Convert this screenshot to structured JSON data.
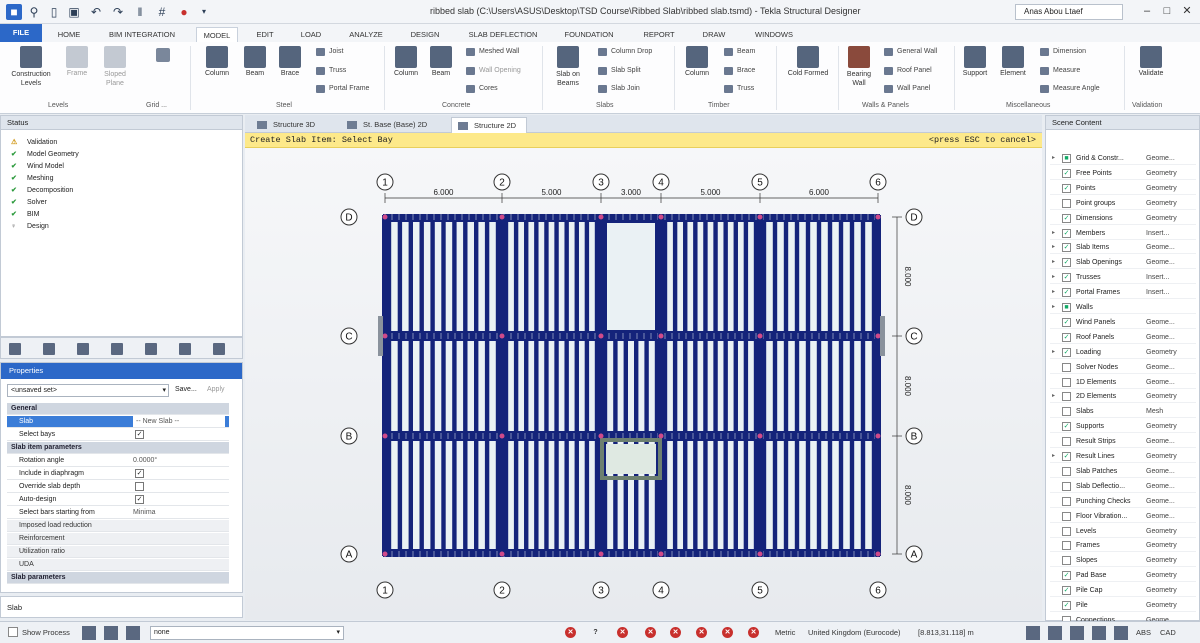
{
  "window": {
    "title": "ribbed slab (C:\\Users\\ASUS\\Desktop\\TSD Course\\Ribbed Slab\\ribbed slab.tsmd) - Tekla Structural Designer",
    "user": "Anas Abou Ltaef",
    "controls": [
      "–",
      "□",
      "✕"
    ]
  },
  "ribbon_tabs": [
    "FILE",
    "HOME",
    "BIM INTEGRATION",
    "MODEL",
    "EDIT",
    "LOAD",
    "ANALYZE",
    "DESIGN",
    "SLAB DEFLECTION",
    "FOUNDATION",
    "REPORT",
    "DRAW",
    "WINDOWS"
  ],
  "ribbon": {
    "construction_levels": "Construction Levels",
    "frame": "Frame",
    "sloped_plane": "Sloped Plane",
    "grid_label": "Grid ...",
    "levels_group": "Levels",
    "steel_column": "Column",
    "steel_beam": "Beam",
    "steel_brace": "Brace",
    "joist": "Joist",
    "truss": "Truss",
    "portal_frame": "Portal Frame",
    "steel_group": "Steel",
    "conc_column": "Column",
    "conc_beam": "Beam",
    "meshed_wall": "Meshed Wall",
    "wall_opening": "Wall Opening",
    "cores": "Cores",
    "concrete_group": "Concrete",
    "slab_on_beams": "Slab on Beams",
    "column_drop": "Column Drop",
    "slab_split": "Slab Split",
    "slab_join": "Slab Join",
    "slabs_group": "Slabs",
    "timber_column": "Column",
    "timber_beam": "Beam",
    "timber_brace": "Brace",
    "timber_truss": "Truss",
    "timber_group": "Timber",
    "cold_formed": "Cold Formed",
    "bearing_wall": "Bearing Wall",
    "general_wall": "General Wall",
    "roof_panel": "Roof Panel",
    "wall_panel": "Wall Panel",
    "walls_group": "Walls & Panels",
    "support": "Support",
    "element": "Element",
    "dimension": "Dimension",
    "measure": "Measure",
    "measure_angle": "Measure Angle",
    "misc_group": "Miscellaneous",
    "validate": "Validate",
    "validation_group": "Validation"
  },
  "status_panel": {
    "title": "Status",
    "items": [
      "Validation",
      "Model Geometry",
      "Wind Model",
      "Meshing",
      "Decomposition",
      "Solver",
      "BIM",
      "Design"
    ]
  },
  "properties": {
    "title": "Properties",
    "set": "<unsaved set>",
    "save": "Save...",
    "apply": "Apply",
    "rows": [
      {
        "kind": "sec",
        "label": "General",
        "value": ""
      },
      {
        "kind": "sel",
        "label": "Slab",
        "value": "-- New Slab --"
      },
      {
        "kind": "chk",
        "label": "Select bays",
        "value": "✓"
      },
      {
        "kind": "sec",
        "label": "Slab item parameters",
        "value": ""
      },
      {
        "kind": "val",
        "label": "Rotation angle",
        "value": "0.0000°"
      },
      {
        "kind": "chk",
        "label": "Include in diaphragm",
        "value": "✓"
      },
      {
        "kind": "chk",
        "label": "Override slab depth",
        "value": ""
      },
      {
        "kind": "chk",
        "label": "Auto-design",
        "value": "✓"
      },
      {
        "kind": "val",
        "label": "Select bars starting from",
        "value": "Minima"
      },
      {
        "kind": "sub",
        "label": "Imposed load reduction",
        "value": ""
      },
      {
        "kind": "sub",
        "label": "Reinforcement",
        "value": ""
      },
      {
        "kind": "sub",
        "label": "Utilization ratio",
        "value": ""
      },
      {
        "kind": "sub",
        "label": "UDA",
        "value": ""
      },
      {
        "kind": "sec",
        "label": "Slab parameters",
        "value": ""
      }
    ],
    "footer": "Slab"
  },
  "view_tabs": [
    "Structure 3D",
    "St. Base (Base) 2D",
    "Structure 2D"
  ],
  "prompt": {
    "left": "Create Slab Item: Select Bay",
    "right": "<press ESC to cancel>"
  },
  "grid": {
    "col_labels": [
      "1",
      "2",
      "3",
      "4",
      "5",
      "6"
    ],
    "row_labels": [
      "D",
      "C",
      "B",
      "A"
    ],
    "spans_x": [
      "6.000",
      "5.000",
      "3.000",
      "5.000",
      "6.000"
    ],
    "spans_y": [
      "8.000",
      "8.000",
      "8.000"
    ]
  },
  "scene_content": {
    "title": "Scene Content",
    "rows": [
      {
        "name": "Grid & Constr...",
        "type": "Geome...",
        "checked": "■",
        "exp": "▸"
      },
      {
        "name": "Free Points",
        "type": "Geometry",
        "checked": "✓",
        "exp": ""
      },
      {
        "name": "Points",
        "type": "Geometry",
        "checked": "✓",
        "exp": ""
      },
      {
        "name": "Point groups",
        "type": "Geometry",
        "checked": "",
        "exp": ""
      },
      {
        "name": "Dimensions",
        "type": "Geometry",
        "checked": "✓",
        "exp": ""
      },
      {
        "name": "Members",
        "type": "Insert...",
        "checked": "✓",
        "exp": "▸"
      },
      {
        "name": "Slab Items",
        "type": "Geome...",
        "checked": "✓",
        "exp": "▸"
      },
      {
        "name": "Slab Openings",
        "type": "Geome...",
        "checked": "✓",
        "exp": "▸"
      },
      {
        "name": "Trusses",
        "type": "Insert...",
        "checked": "✓",
        "exp": "▸"
      },
      {
        "name": "Portal Frames",
        "type": "Insert...",
        "checked": "✓",
        "exp": "▸"
      },
      {
        "name": "Walls",
        "type": "",
        "checked": "■",
        "exp": "▸"
      },
      {
        "name": "Wind Panels",
        "type": "Geome...",
        "checked": "✓",
        "exp": ""
      },
      {
        "name": "Roof Panels",
        "type": "Geome...",
        "checked": "✓",
        "exp": ""
      },
      {
        "name": "Loading",
        "type": "Geometry",
        "checked": "✓",
        "exp": "▸"
      },
      {
        "name": "Solver Nodes",
        "type": "Geome...",
        "checked": "",
        "exp": ""
      },
      {
        "name": "1D Elements",
        "type": "Geome...",
        "checked": "",
        "exp": ""
      },
      {
        "name": "2D Elements",
        "type": "Geometry",
        "checked": "",
        "exp": "▸"
      },
      {
        "name": "Slabs",
        "type": "Mesh",
        "checked": "",
        "exp": ""
      },
      {
        "name": "Supports",
        "type": "Geometry",
        "checked": "✓",
        "exp": ""
      },
      {
        "name": "Result Strips",
        "type": "Geome...",
        "checked": "",
        "exp": ""
      },
      {
        "name": "Result Lines",
        "type": "Geometry",
        "checked": "✓",
        "exp": "▸"
      },
      {
        "name": "Slab Patches",
        "type": "Geome...",
        "checked": "",
        "exp": ""
      },
      {
        "name": "Slab Deflectio...",
        "type": "Geome...",
        "checked": "",
        "exp": ""
      },
      {
        "name": "Punching Checks",
        "type": "Geome...",
        "checked": "",
        "exp": ""
      },
      {
        "name": "Floor Vibration...",
        "type": "Geome...",
        "checked": "",
        "exp": ""
      },
      {
        "name": "Levels",
        "type": "Geometry",
        "checked": "",
        "exp": ""
      },
      {
        "name": "Frames",
        "type": "Geometry",
        "checked": "",
        "exp": ""
      },
      {
        "name": "Slopes",
        "type": "Geometry",
        "checked": "",
        "exp": ""
      },
      {
        "name": "Pad Base",
        "type": "Geometry",
        "checked": "✓",
        "exp": ""
      },
      {
        "name": "Pile Cap",
        "type": "Geometry",
        "checked": "✓",
        "exp": ""
      },
      {
        "name": "Pile",
        "type": "Geometry",
        "checked": "✓",
        "exp": ""
      },
      {
        "name": "Connections",
        "type": "Geome...",
        "checked": "",
        "exp": ""
      }
    ]
  },
  "statusbar": {
    "show_process": "Show Process",
    "combo": "none",
    "units": "Metric",
    "code": "United Kingdom (Eurocode)",
    "coords": "[8.813,31.118] m",
    "abs": "ABS",
    "cad": "CAD"
  },
  "colors": {
    "accent": "#2c68c8",
    "beam": "#14237a",
    "prompt_bg": "#fde98a",
    "slab_fill": "#eaf1f4"
  }
}
